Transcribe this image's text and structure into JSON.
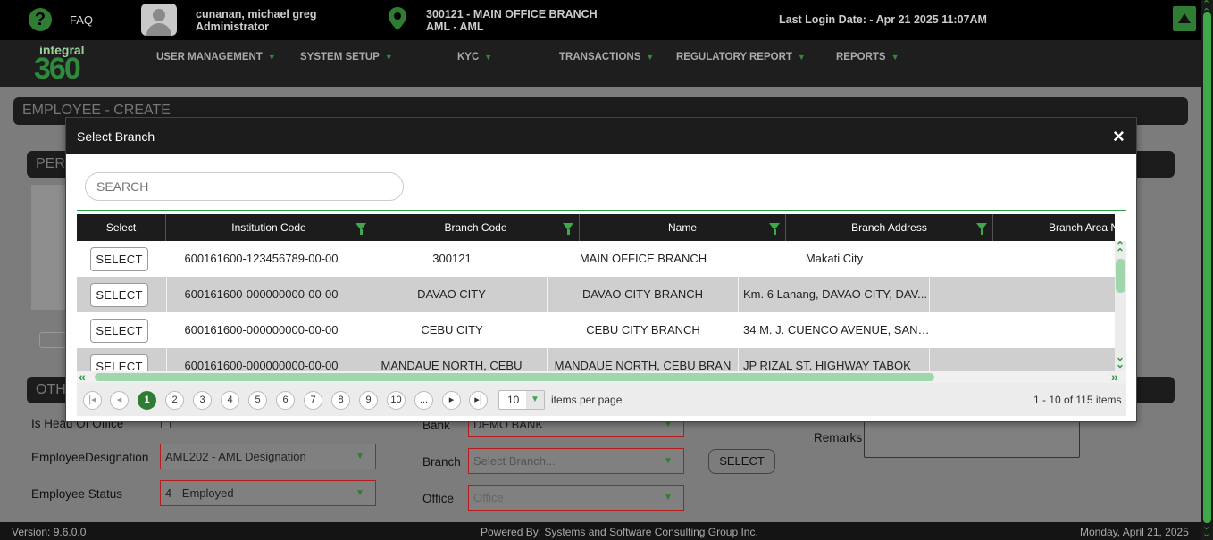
{
  "topbar": {
    "faq": "FAQ",
    "user_name": "cunanan, michael greg",
    "user_role": "Administrator",
    "branch_line1": "300121 - MAIN OFFICE BRANCH",
    "branch_line2": "AML - AML",
    "last_login": "Last Login Date: - Apr 21 2025 11:07AM"
  },
  "logo": {
    "line1": "integral",
    "line2": "360"
  },
  "nav": [
    "USER MANAGEMENT",
    "SYSTEM SETUP",
    "KYC",
    "TRANSACTIONS",
    "REGULATORY REPORT",
    "REPORTS"
  ],
  "page": {
    "title": "EMPLOYEE - CREATE",
    "section_personal": "PERS",
    "section_other": "OTH"
  },
  "form": {
    "is_head_office_label": "Is Head Of Office",
    "designation_label": "EmployeeDesignation",
    "designation_value": "AML202 - AML Designation",
    "status_label": "Employee Status",
    "status_value": "4 - Employed",
    "bank_label": "Bank",
    "bank_value": "DEMO BANK",
    "branch_label": "Branch",
    "branch_placeholder": "Select Branch...",
    "office_label": "Office",
    "office_placeholder": "Office",
    "select_button": "SELECT",
    "remarks_label": "Remarks"
  },
  "modal": {
    "title": "Select Branch",
    "close": "×",
    "search_placeholder": "SEARCH",
    "columns": [
      "Select",
      "Institution Code",
      "Branch Code",
      "Name",
      "Branch Address",
      "Branch Area Na"
    ],
    "rows": [
      {
        "select": "SELECT",
        "institution_code": "600161600-123456789-00-00",
        "branch_code": "300121",
        "name": "MAIN OFFICE BRANCH",
        "address": "Makati City"
      },
      {
        "select": "SELECT",
        "institution_code": "600161600-000000000-00-00",
        "branch_code": "DAVAO CITY",
        "name": "DAVAO CITY BRANCH",
        "address": "Km. 6 Lanang, DAVAO CITY, DAV..."
      },
      {
        "select": "SELECT",
        "institution_code": "600161600-000000000-00-00",
        "branch_code": "CEBU CITY",
        "name": "CEBU CITY BRANCH",
        "address": "34 M. J. CUENCO AVENUE, SAN ..."
      },
      {
        "select": "SELECT",
        "institution_code": "600161600-000000000-00-00",
        "branch_code": "MANDAUE NORTH, CEBU",
        "name": "MANDAUE NORTH, CEBU BRAN",
        "address": "JP RIZAL ST. HIGHWAY TABOK"
      }
    ],
    "pager": {
      "pages": [
        "1",
        "2",
        "3",
        "4",
        "5",
        "6",
        "7",
        "8",
        "9",
        "10",
        "..."
      ],
      "page_size": "10",
      "items_per_page": "items per page",
      "summary": "1 - 10 of 115 items"
    }
  },
  "footer": {
    "version": "Version: 9.6.0.0",
    "powered": "Powered By: Systems and Software Consulting Group Inc.",
    "date": "Monday, April 21, 2025"
  },
  "colors": {
    "accent": "#2e7d32",
    "header": "#1c1c1c",
    "error_border": "#b71c1c"
  }
}
